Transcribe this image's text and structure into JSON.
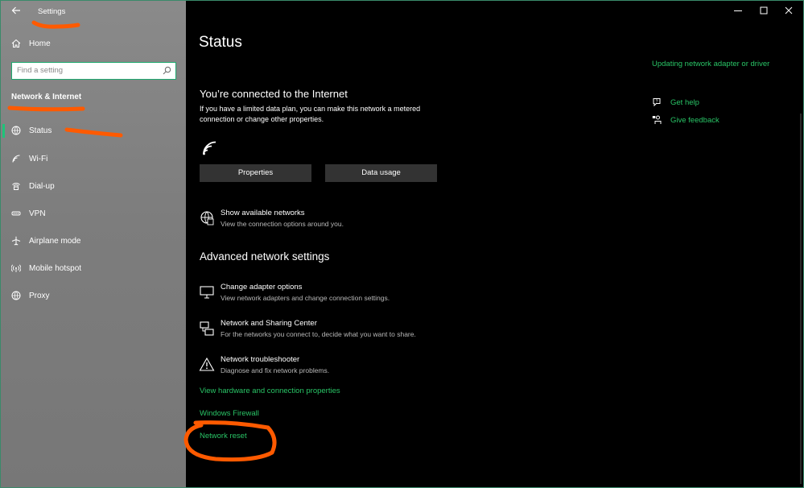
{
  "window": {
    "app_title": "Settings"
  },
  "sidebar": {
    "home_label": "Home",
    "search_placeholder": "Find a setting",
    "section_title": "Network & Internet",
    "items": [
      {
        "label": "Status",
        "icon": "globe-status-icon"
      },
      {
        "label": "Wi-Fi",
        "icon": "wifi-icon"
      },
      {
        "label": "Dial-up",
        "icon": "dialup-icon"
      },
      {
        "label": "VPN",
        "icon": "vpn-icon"
      },
      {
        "label": "Airplane mode",
        "icon": "airplane-icon"
      },
      {
        "label": "Mobile hotspot",
        "icon": "hotspot-icon"
      },
      {
        "label": "Proxy",
        "icon": "globe-icon"
      }
    ]
  },
  "main": {
    "title": "Status",
    "connection_heading": "You’re connected to the Internet",
    "connection_desc": "If you have a limited data plan, you can make this network a metered connection or change other properties.",
    "properties_button": "Properties",
    "data_usage_button": "Data usage",
    "show_networks": {
      "title": "Show available networks",
      "desc": "View the connection options around you."
    },
    "advanced_heading": "Advanced network settings",
    "adapter_options": {
      "title": "Change adapter options",
      "desc": "View network adapters and change connection settings."
    },
    "sharing_center": {
      "title": "Network and Sharing Center",
      "desc": "For the networks you connect to, decide what you want to share."
    },
    "troubleshooter": {
      "title": "Network troubleshooter",
      "desc": "Diagnose and fix network problems."
    },
    "links": {
      "hardware_props": "View hardware and connection properties",
      "firewall": "Windows Firewall",
      "network_reset": "Network reset"
    }
  },
  "right_panel": {
    "updating_link": "Updating network adapter or driver",
    "get_help": "Get help",
    "give_feedback": "Give feedback"
  },
  "colors": {
    "accent": "#1ec47a",
    "link": "#29c466",
    "annotation": "#ff5a00"
  }
}
